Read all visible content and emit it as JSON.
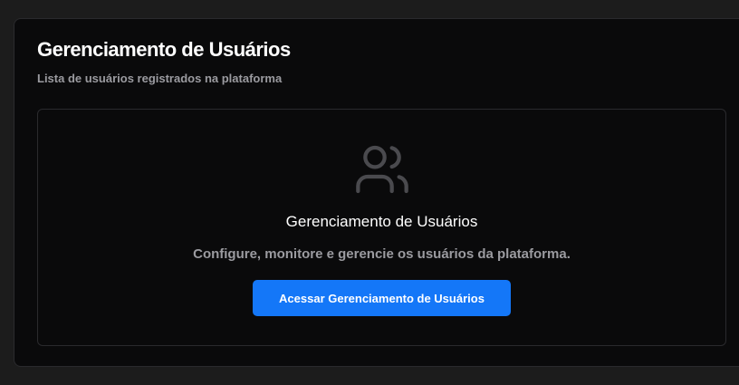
{
  "card": {
    "title": "Gerenciamento de Usuários",
    "subtitle": "Lista de usuários registrados na plataforma"
  },
  "empty_state": {
    "icon": "users-icon",
    "heading": "Gerenciamento de Usuários",
    "description": "Configure, monitore e gerencie os usuários da plataforma.",
    "button_label": "Acessar Gerenciamento de Usuários"
  },
  "colors": {
    "page_background": "#1c1c1c",
    "card_background": "#0a0a0b",
    "border": "#2a2a2d",
    "muted_text": "#9b9ba0",
    "accent": "#1477f8"
  }
}
